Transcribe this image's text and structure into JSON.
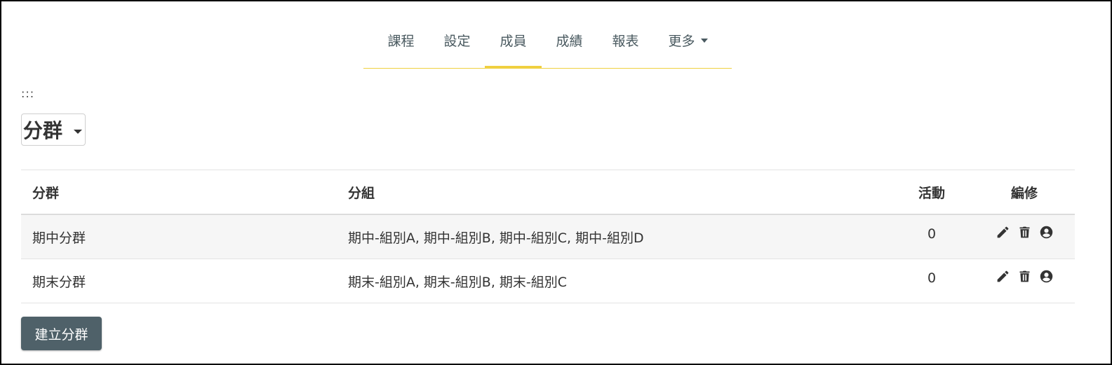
{
  "nav": {
    "items": [
      {
        "label": "課程",
        "active": false
      },
      {
        "label": "設定",
        "active": false
      },
      {
        "label": "成員",
        "active": true
      },
      {
        "label": "成績",
        "active": false
      },
      {
        "label": "報表",
        "active": false
      },
      {
        "label": "更多",
        "active": false,
        "dropdown": true
      }
    ],
    "accent_color": "#f0d040"
  },
  "dots": ":::",
  "selector": {
    "title": "分群"
  },
  "table": {
    "headers": {
      "name": "分群",
      "subgroups": "分組",
      "activity": "活動",
      "edit": "編修"
    },
    "rows": [
      {
        "name": "期中分群",
        "subgroups": "期中-組別A, 期中-組別B, 期中-組別C, 期中-組別D",
        "activity": "0",
        "actions": [
          "pencil-icon",
          "trash-icon",
          "user-circle-icon"
        ]
      },
      {
        "name": "期末分群",
        "subgroups": "期末-組別A, 期末-組別B, 期末-組別C",
        "activity": "0",
        "actions": [
          "pencil-icon",
          "trash-icon",
          "user-circle-icon"
        ]
      }
    ]
  },
  "create_button": {
    "label": "建立分群",
    "color": "#4f6169"
  }
}
